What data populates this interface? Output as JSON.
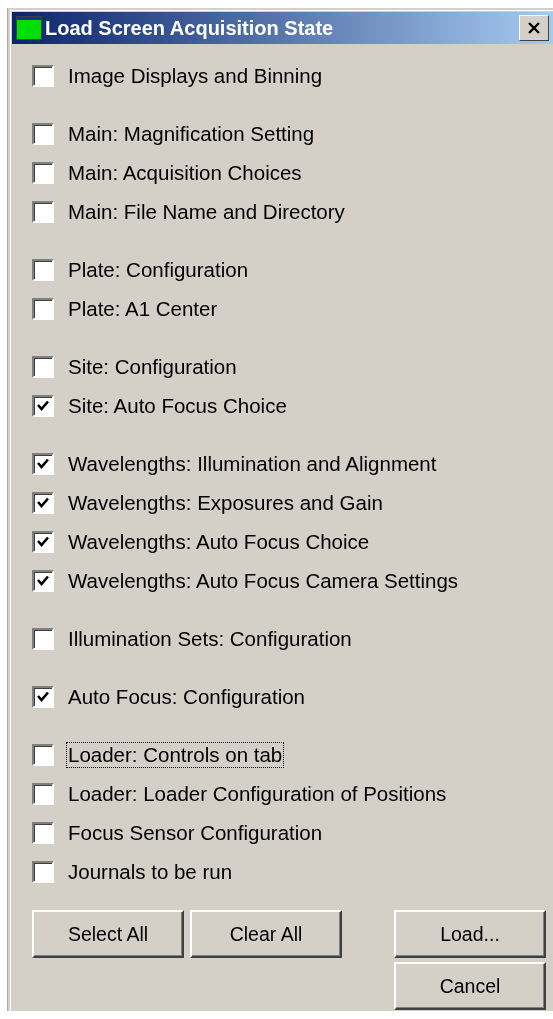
{
  "window": {
    "title": "Load Screen Acquisition State"
  },
  "groups": [
    {
      "items": [
        {
          "label": "Image Displays and Binning",
          "checked": false,
          "focused": false
        }
      ]
    },
    {
      "items": [
        {
          "label": "Main: Magnification Setting",
          "checked": false,
          "focused": false
        },
        {
          "label": "Main: Acquisition Choices",
          "checked": false,
          "focused": false
        },
        {
          "label": "Main: File Name and Directory",
          "checked": false,
          "focused": false
        }
      ]
    },
    {
      "items": [
        {
          "label": "Plate: Configuration",
          "checked": false,
          "focused": false
        },
        {
          "label": "Plate: A1 Center",
          "checked": false,
          "focused": false
        }
      ]
    },
    {
      "items": [
        {
          "label": "Site: Configuration",
          "checked": false,
          "focused": false
        },
        {
          "label": "Site: Auto Focus Choice",
          "checked": true,
          "focused": false
        }
      ]
    },
    {
      "items": [
        {
          "label": "Wavelengths: Illumination and Alignment",
          "checked": true,
          "focused": false
        },
        {
          "label": "Wavelengths: Exposures and Gain",
          "checked": true,
          "focused": false
        },
        {
          "label": "Wavelengths: Auto Focus Choice",
          "checked": true,
          "focused": false
        },
        {
          "label": "Wavelengths: Auto Focus Camera Settings",
          "checked": true,
          "focused": false
        }
      ]
    },
    {
      "items": [
        {
          "label": "Illumination Sets: Configuration",
          "checked": false,
          "focused": false
        }
      ]
    },
    {
      "items": [
        {
          "label": "Auto Focus: Configuration",
          "checked": true,
          "focused": false
        }
      ]
    },
    {
      "items": [
        {
          "label": "Loader: Controls on tab",
          "checked": false,
          "focused": true
        },
        {
          "label": "Loader: Loader Configuration of Positions",
          "checked": false,
          "focused": false
        },
        {
          "label": "Focus Sensor Configuration",
          "checked": false,
          "focused": false
        },
        {
          "label": "Journals to be run",
          "checked": false,
          "focused": false
        }
      ]
    }
  ],
  "buttons": {
    "select_all": "Select All",
    "clear_all": "Clear All",
    "load": "Load...",
    "cancel": "Cancel"
  }
}
